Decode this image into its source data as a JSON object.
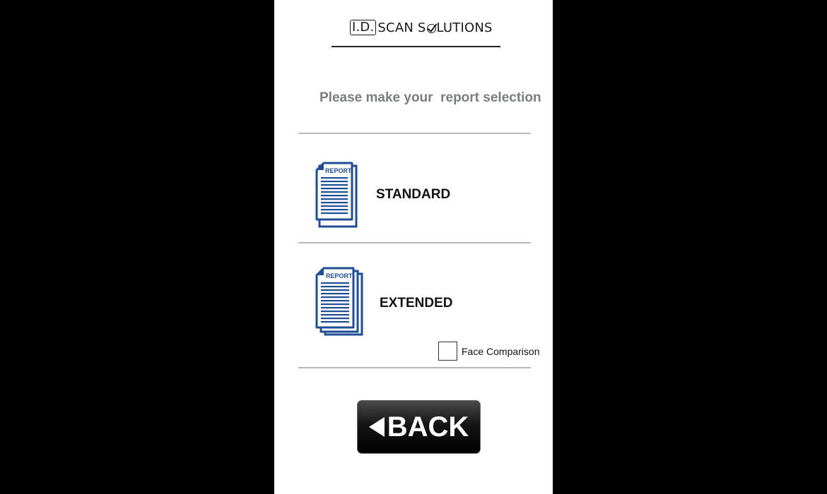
{
  "header": {
    "logo_box_text": "I.D.",
    "logo_text_a": "SCAN S",
    "logo_text_b": "LUTIONS"
  },
  "prompt": "Please make your  report selection",
  "options": [
    {
      "icon_text": "REPORT",
      "label": "STANDARD"
    },
    {
      "icon_text": "REPORT",
      "label": "EXTENDED"
    }
  ],
  "face_comparison": {
    "label": "Face Comparison",
    "checked": false
  },
  "back_button": {
    "label": "BACK"
  },
  "colors": {
    "icon_blue": "#1f4e96",
    "prompt_gray": "#7a7e7a",
    "background": "#000000"
  }
}
